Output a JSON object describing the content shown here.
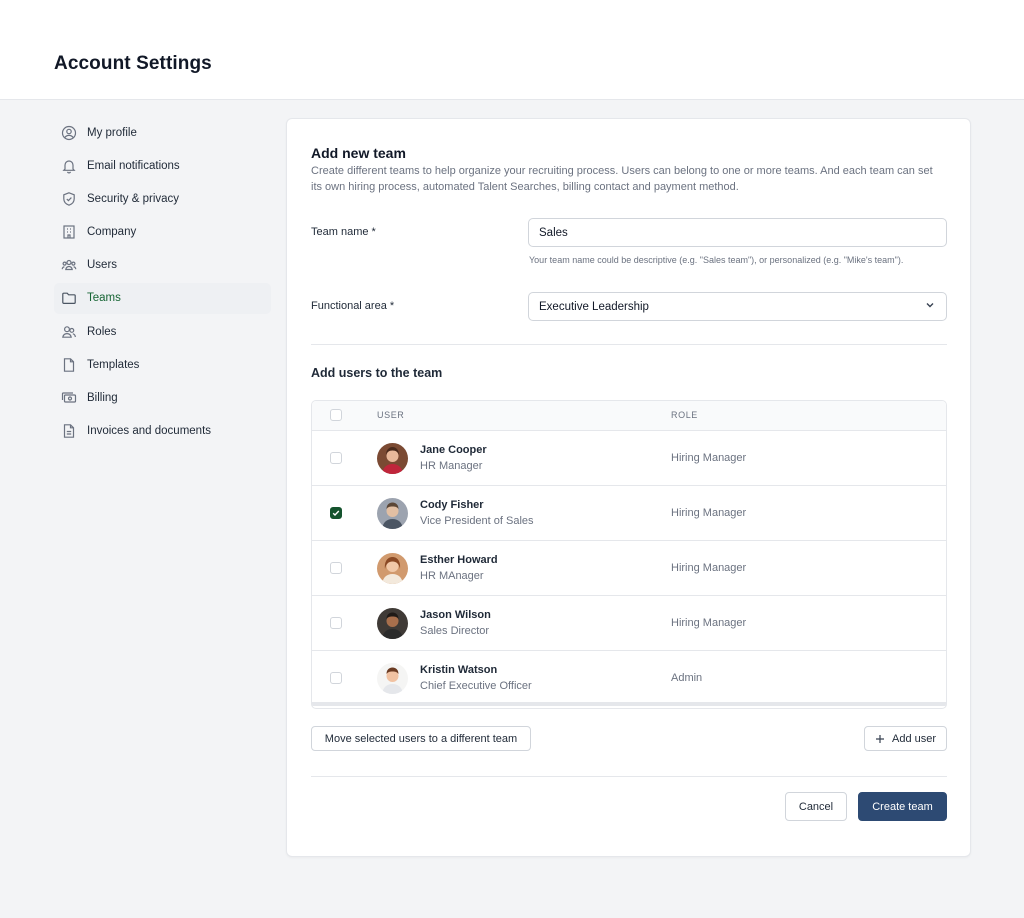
{
  "header": {
    "title": "Account Settings"
  },
  "sidebar": {
    "items": [
      {
        "label": "My profile",
        "icon": "user-circle-icon",
        "active": false
      },
      {
        "label": "Email notifications",
        "icon": "bell-icon",
        "active": false
      },
      {
        "label": "Security & privacy",
        "icon": "shield-icon",
        "active": false
      },
      {
        "label": "Company",
        "icon": "building-icon",
        "active": false
      },
      {
        "label": "Users",
        "icon": "users-icon",
        "active": false
      },
      {
        "label": "Teams",
        "icon": "folder-icon",
        "active": true
      },
      {
        "label": "Roles",
        "icon": "user-group-icon",
        "active": false
      },
      {
        "label": "Templates",
        "icon": "document-icon",
        "active": false
      },
      {
        "label": "Billing",
        "icon": "cash-icon",
        "active": false
      },
      {
        "label": "Invoices and documents",
        "icon": "document-text-icon",
        "active": false
      }
    ]
  },
  "form": {
    "title": "Add new team",
    "description": "Create different teams to help organize your recruiting process. Users can belong to one or more teams. And each team can set its own hiring process, automated Talent Searches, billing contact and payment method.",
    "team_name": {
      "label": "Team name *",
      "value": "Sales",
      "hint": "Your team name could be descriptive (e.g. \"Sales team\"), or personalized (e.g. \"Mike's team\")."
    },
    "functional_area": {
      "label": "Functional area *",
      "value": "Executive Leadership"
    }
  },
  "users_section": {
    "title": "Add users to the team",
    "columns": {
      "user": "USER",
      "role": "ROLE"
    },
    "rows": [
      {
        "name": "Jane Cooper",
        "title": "HR Manager",
        "role": "Hiring Manager",
        "checked": false
      },
      {
        "name": "Cody Fisher",
        "title": "Vice President of Sales",
        "role": "Hiring Manager",
        "checked": true
      },
      {
        "name": "Esther Howard",
        "title": "HR MAnager",
        "role": "Hiring Manager",
        "checked": false
      },
      {
        "name": "Jason Wilson",
        "title": "Sales Director",
        "role": "Hiring Manager",
        "checked": false
      },
      {
        "name": "Kristin Watson",
        "title": "Chief Executive Officer",
        "role": "Admin",
        "checked": false
      }
    ],
    "move_button": "Move selected users to a different team",
    "add_user_button": "Add user"
  },
  "actions": {
    "cancel": "Cancel",
    "create": "Create team"
  },
  "colors": {
    "primary": "#2d4a73",
    "active_nav_text": "#166534",
    "checkbox_checked": "#14532d"
  }
}
